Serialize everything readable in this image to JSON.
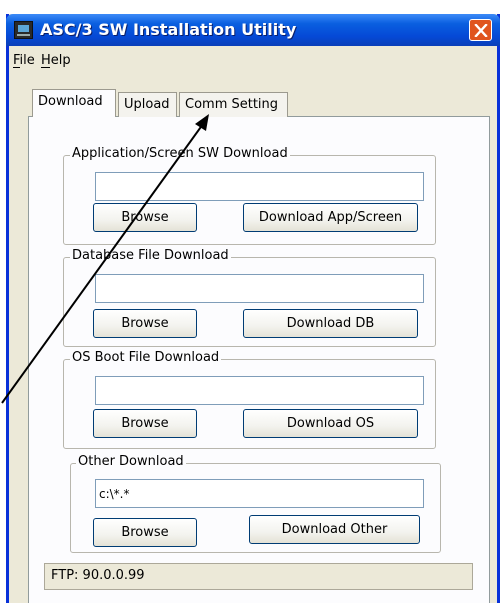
{
  "window": {
    "title": "ASC/3 SW Installation Utility"
  },
  "menu": {
    "file_label": "File",
    "help_label": "Help"
  },
  "tabs": [
    {
      "label": "Download",
      "selected": true
    },
    {
      "label": "Upload",
      "selected": false
    },
    {
      "label": "Comm Setting",
      "selected": false
    }
  ],
  "groups": {
    "app": {
      "label": "Application/Screen SW Download",
      "path": "",
      "browse": "Browse",
      "download": "Download App/Screen"
    },
    "db": {
      "label": "Database File Download",
      "path": "",
      "browse": "Browse",
      "download": "Download DB"
    },
    "os": {
      "label": "OS Boot File Download",
      "path": "",
      "browse": "Browse",
      "download": "Download OS"
    },
    "other": {
      "label": "Other Download",
      "path": "c:\\*.*",
      "browse": "Browse",
      "download": "Download Other"
    }
  },
  "status": {
    "text": "FTP: 90.0.0.99"
  },
  "colors": {
    "title_bar": "#0a5fe0",
    "close_button": "#e0541e",
    "window_face": "#ece9d8",
    "panel_face": "#fcfcfe"
  },
  "icons": {
    "app": "computer-icon",
    "close": "close-icon",
    "annotation": "arrow-icon"
  }
}
